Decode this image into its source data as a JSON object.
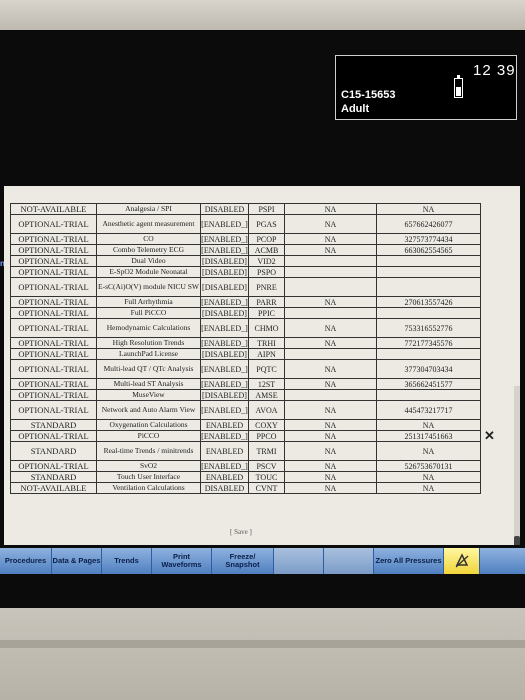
{
  "header": {
    "patient_id": "C15-15653",
    "patient_category": "Adult",
    "clock": "12 39",
    "battery_level": 0.55
  },
  "side_tag": "nt",
  "table": {
    "cut_row": [
      "",
      "",
      "[DISABLED]",
      ""
    ],
    "rows": [
      {
        "status": "NOT-AVAILABLE",
        "description": "Analgesia / SPI",
        "state": "DISABLED",
        "code": "PSPI",
        "na": "NA",
        "key": "NA"
      },
      {
        "status": "OPTIONAL-TRIAL",
        "description": "Anesthetic agent measurement",
        "state": "[ENABLED_]",
        "code": "PGAS",
        "na": "NA",
        "key": "657662426077"
      },
      {
        "status": "OPTIONAL-TRIAL",
        "description": "CO",
        "state": "[ENABLED_]",
        "code": "PCOP",
        "na": "NA",
        "key": "327573774434"
      },
      {
        "status": "OPTIONAL-TRIAL",
        "description": "Combo Telemetry ECG",
        "state": "[ENABLED_]",
        "code": "ACMB",
        "na": "NA",
        "key": "663062554565"
      },
      {
        "status": "OPTIONAL-TRIAL",
        "description": "Dual Video",
        "state": "[DISABLED]",
        "code": "VID2",
        "na": "",
        "key": ""
      },
      {
        "status": "OPTIONAL-TRIAL",
        "description": "E-SpO2 Module Neonatal",
        "state": "[DISABLED]",
        "code": "PSPO",
        "na": "",
        "key": ""
      },
      {
        "status": "OPTIONAL-TRIAL",
        "description": "E-sC(Ai)O(V) module NICU SW",
        "state": "[DISABLED]",
        "code": "PNRE",
        "na": "",
        "key": ""
      },
      {
        "status": "OPTIONAL-TRIAL",
        "description": "Full Arrhythmia",
        "state": "[ENABLED_]",
        "code": "PARR",
        "na": "NA",
        "key": "270613557426"
      },
      {
        "status": "OPTIONAL-TRIAL",
        "description": "Full PiCCO",
        "state": "[DISABLED]",
        "code": "PPIC",
        "na": "",
        "key": ""
      },
      {
        "status": "OPTIONAL-TRIAL",
        "description": "Hemodynamic Calculations",
        "state": "[ENABLED_]",
        "code": "CHMO",
        "na": "NA",
        "key": "753316552776"
      },
      {
        "status": "OPTIONAL-TRIAL",
        "description": "High Resolution Trends",
        "state": "[ENABLED_]",
        "code": "TRHI",
        "na": "NA",
        "key": "772177345576"
      },
      {
        "status": "OPTIONAL-TRIAL",
        "description": "LaunchPad License",
        "state": "[DISABLED]",
        "code": "AIPN",
        "na": "",
        "key": ""
      },
      {
        "status": "OPTIONAL-TRIAL",
        "description": "Multi-lead QT / QTc Analysis",
        "state": "[ENABLED_]",
        "code": "PQTC",
        "na": "NA",
        "key": "377304703434"
      },
      {
        "status": "OPTIONAL-TRIAL",
        "description": "Multi-lead ST Analysis",
        "state": "[ENABLED_]",
        "code": "12ST",
        "na": "NA",
        "key": "365662451577"
      },
      {
        "status": "OPTIONAL-TRIAL",
        "description": "MuseView",
        "state": "[DISABLED]",
        "code": "AMSE",
        "na": "",
        "key": ""
      },
      {
        "status": "OPTIONAL-TRIAL",
        "description": "Network and Auto Alarm View",
        "state": "[ENABLED_]",
        "code": "AVOA",
        "na": "NA",
        "key": "445473217717"
      },
      {
        "status": "STANDARD",
        "description": "Oxygenation Calculations",
        "state": "ENABLED",
        "code": "COXY",
        "na": "NA",
        "key": "NA"
      },
      {
        "status": "OPTIONAL-TRIAL",
        "description": "PiCCO",
        "state": "[ENABLED_]",
        "code": "PPCO",
        "na": "NA",
        "key": "251317451663"
      },
      {
        "status": "STANDARD",
        "description": "Real-time Trends / minitrends",
        "state": "ENABLED",
        "code": "TRMI",
        "na": "NA",
        "key": "NA"
      },
      {
        "status": "OPTIONAL-TRIAL",
        "description": "SvO2",
        "state": "[ENABLED_]",
        "code": "PSCV",
        "na": "NA",
        "key": "526753670131"
      },
      {
        "status": "STANDARD",
        "description": "Touch User Interface",
        "state": "ENABLED",
        "code": "TOUC",
        "na": "NA",
        "key": "NA"
      },
      {
        "status": "NOT-AVAILABLE",
        "description": "Ventilation Calculations",
        "state": "DISABLED",
        "code": "CVNT",
        "na": "NA",
        "key": "NA"
      }
    ]
  },
  "save_label": "[ Save ]",
  "toolbar": {
    "buttons": [
      {
        "label": "Procedures",
        "dim": false
      },
      {
        "label": "Data & Pages",
        "dim": false
      },
      {
        "label": "Trends",
        "dim": false
      },
      {
        "label": "Print Waveforms",
        "dim": false
      },
      {
        "label": "Freeze/ Snapshot",
        "dim": false
      },
      {
        "label": "",
        "dim": true
      },
      {
        "label": "",
        "dim": true
      },
      {
        "label": "Zero All Pressures",
        "dim": false
      }
    ],
    "alarm_icon": "alarm-silence-icon"
  }
}
